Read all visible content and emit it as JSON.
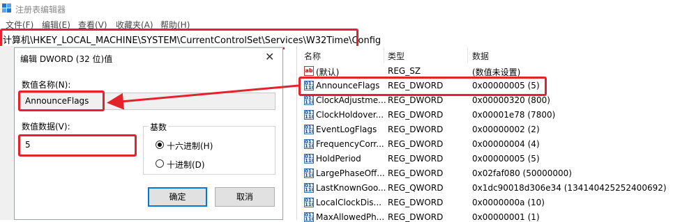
{
  "window": {
    "title": "注册表编辑器",
    "app_icon": "regedit-icon"
  },
  "menu": [
    "文件(F)",
    "编辑(E)",
    "查看(V)",
    "收藏夹(A)",
    "帮助(H)"
  ],
  "address": {
    "path": "计算机\\HKEY_LOCAL_MACHINE\\SYSTEM\\CurrentControlSet\\Services\\W32Time\\Config"
  },
  "dialog": {
    "title": "编辑 DWORD (32 位)值",
    "close_icon": "close-icon",
    "name_label": "数值名称(N):",
    "name_value": "AnnounceFlags",
    "data_label": "数值数据(V):",
    "data_value": "5",
    "base_label": "基数",
    "radio_hex": "十六进制(H)",
    "radio_dec": "十进制(D)",
    "selected_base": "hex",
    "ok": "确定",
    "cancel": "取消"
  },
  "list": {
    "headers": {
      "name": "名称",
      "type": "类型",
      "data": "数据"
    },
    "rows": [
      {
        "name": "(默认)",
        "type": "REG_SZ",
        "data": "(数值未设置)",
        "icon": "string-value-icon"
      },
      {
        "name": "AnnounceFlags",
        "type": "REG_DWORD",
        "data": "0x00000005 (5)",
        "icon": "binary-value-icon"
      },
      {
        "name": "ClockAdjustme...",
        "type": "REG_DWORD",
        "data": "0x00000320 (800)",
        "icon": "binary-value-icon"
      },
      {
        "name": "ClockHoldover...",
        "type": "REG_DWORD",
        "data": "0x00001e78 (7800)",
        "icon": "binary-value-icon"
      },
      {
        "name": "EventLogFlags",
        "type": "REG_DWORD",
        "data": "0x00000002 (2)",
        "icon": "binary-value-icon"
      },
      {
        "name": "FrequencyCorr...",
        "type": "REG_DWORD",
        "data": "0x00000004 (4)",
        "icon": "binary-value-icon"
      },
      {
        "name": "HoldPeriod",
        "type": "REG_DWORD",
        "data": "0x00000005 (5)",
        "icon": "binary-value-icon"
      },
      {
        "name": "LargePhaseOff...",
        "type": "REG_DWORD",
        "data": "0x02faf080 (50000000)",
        "icon": "binary-value-icon"
      },
      {
        "name": "LastKnownGoo...",
        "type": "REG_QWORD",
        "data": "0x1dc90018d306e34 (134140425252400692)",
        "icon": "binary-value-icon"
      },
      {
        "name": "LocalClockDis...",
        "type": "REG_DWORD",
        "data": "0x0000000a (10)",
        "icon": "binary-value-icon"
      },
      {
        "name": "MaxAllowedPh...",
        "type": "REG_DWORD",
        "data": "0x00000001 (1)",
        "icon": "binary-value-icon"
      }
    ]
  },
  "colors": {
    "highlight": "#e3222c",
    "accent": "#0078d7"
  }
}
